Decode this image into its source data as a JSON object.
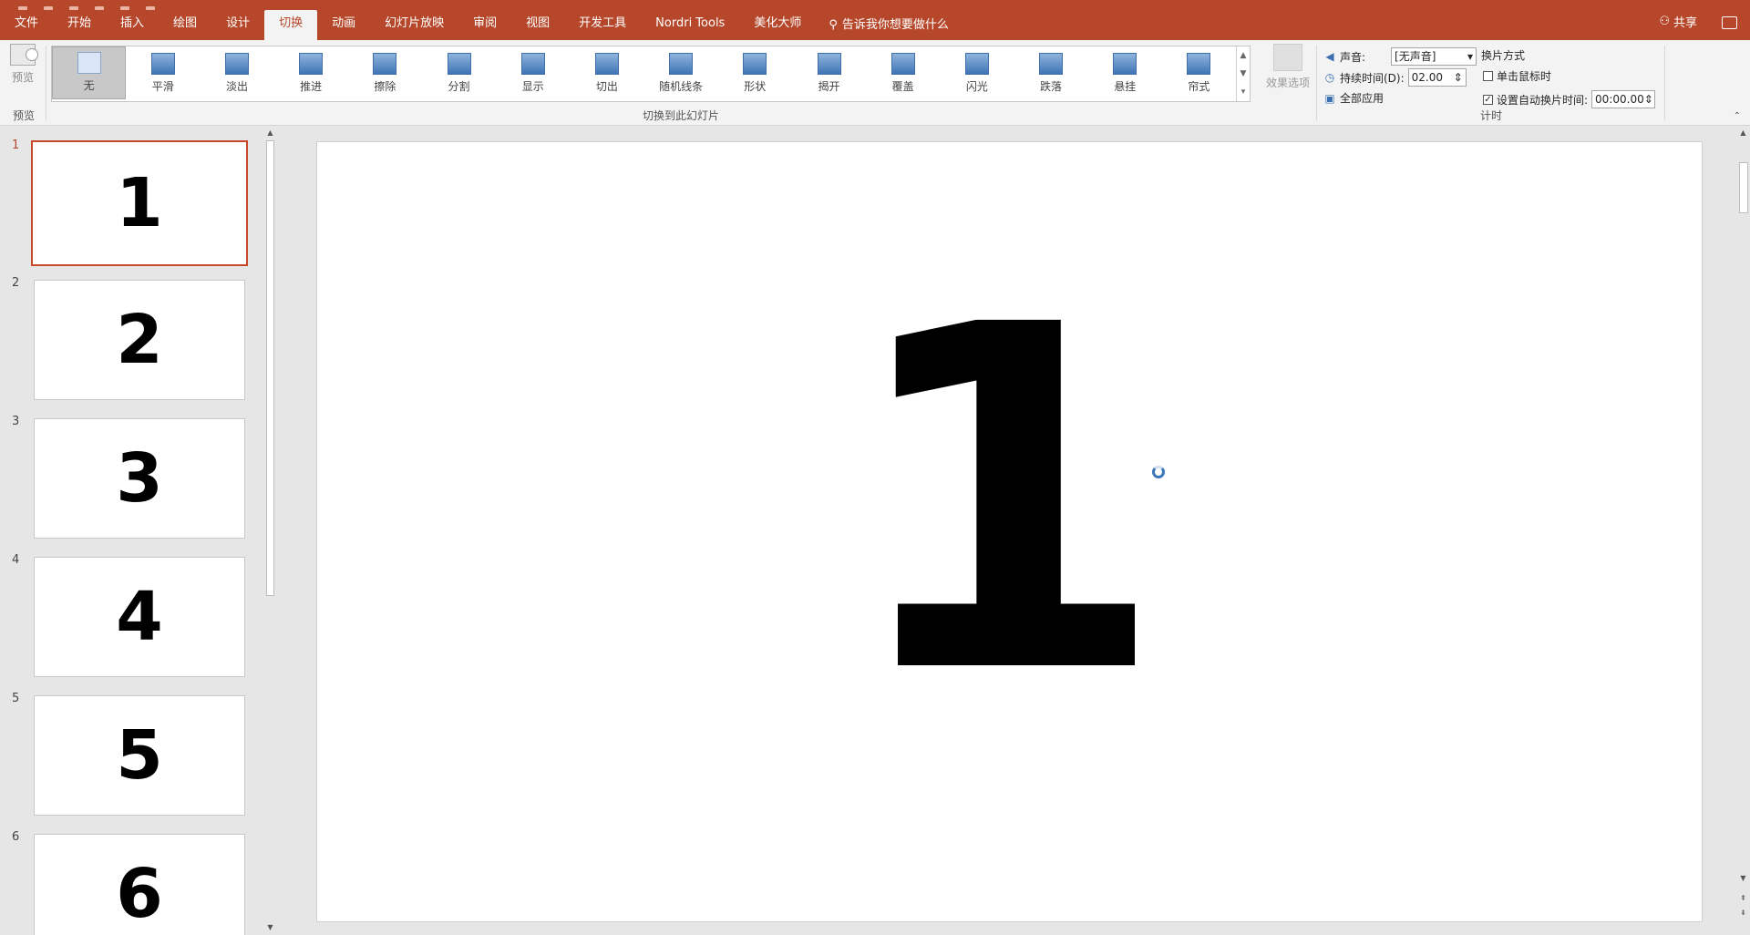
{
  "tabs": [
    "文件",
    "开始",
    "插入",
    "绘图",
    "设计",
    "切换",
    "动画",
    "幻灯片放映",
    "审阅",
    "视图",
    "开发工具",
    "Nordri Tools",
    "美化大师"
  ],
  "active_tab": "切换",
  "tell_me": "告诉我你想要做什么",
  "share": "共享",
  "ribbon": {
    "preview_label": "预览",
    "preview_group": "预览",
    "transitions_group": "切换到此幻灯片",
    "transitions": [
      "无",
      "平滑",
      "淡出",
      "推进",
      "擦除",
      "分割",
      "显示",
      "切出",
      "随机线条",
      "形状",
      "揭开",
      "覆盖",
      "闪光",
      "跌落",
      "悬挂",
      "帘式"
    ],
    "selected_transition": "无",
    "effect_options": "效果选项",
    "timing_group": "计时",
    "sound_label": "声音:",
    "sound_value": "[无声音]",
    "duration_label": "持续时间(D):",
    "duration_value": "02.00",
    "apply_all": "全部应用",
    "advance_label": "换片方式",
    "on_click_label": "单击鼠标时",
    "after_label": "设置自动换片时间:",
    "after_value": "00:00.00"
  },
  "slides": [
    {
      "number": "1",
      "text": "1"
    },
    {
      "number": "2",
      "text": "2"
    },
    {
      "number": "3",
      "text": "3"
    },
    {
      "number": "4",
      "text": "4"
    },
    {
      "number": "5",
      "text": "5"
    },
    {
      "number": "6",
      "text": "6"
    }
  ],
  "current_slide": {
    "text": "1"
  },
  "colors": {
    "accent": "#b7472a",
    "selection": "#c9472b"
  }
}
